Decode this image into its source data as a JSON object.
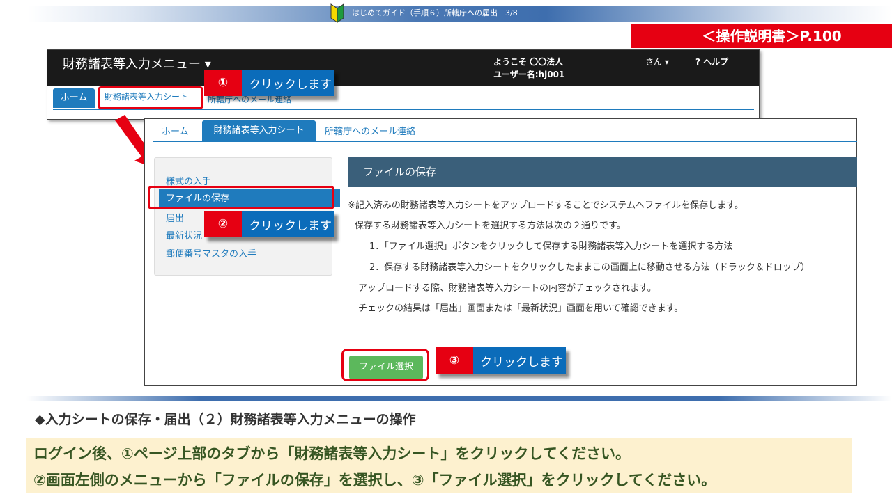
{
  "header": {
    "title": "はじめてガイド（手順６）所轄庁への届出　3/8",
    "manual_ref": "＜操作説明書＞P.100"
  },
  "screenshot1": {
    "app_title": "財務諸表等入力メニュー ▾",
    "welcome": "ようこそ 〇〇法人",
    "username": "ユーザー名:hj001",
    "san_menu": "さん ▾",
    "help": "? ヘルプ",
    "tabs": {
      "home": "ホーム",
      "sheet": "財務諸表等入力シート",
      "mail": "所轄庁へのメール連絡"
    }
  },
  "screenshot2": {
    "tabs": {
      "home": "ホーム",
      "sheet": "財務諸表等入力シート",
      "mail": "所轄庁へのメール連絡"
    },
    "sidebar": {
      "items": [
        "様式の入手",
        "ファイルの保存",
        "届出",
        "最新状況",
        "郵便番号マスタの入手"
      ]
    },
    "panel": {
      "title": "ファイルの保存",
      "paragraphs": [
        "※記入済みの財務諸表等入力シートをアップロードすることでシステムへファイルを保存します。",
        "保存する財務諸表等入力シートを選択する方法は次の２通りです。",
        "1．「ファイル選択」ボタンをクリックして保存する財務諸表等入力シートを選択する方法",
        "2．保存する財務諸表等入力シートをクリックしたままこの画面上に移動させる方法（ドラック＆ドロップ）",
        "アップロードする際、財務諸表等入力シートの内容がチェックされます。",
        "チェックの結果は「届出」画面または「最新状況」画面を用いて確認できます。"
      ],
      "file_button": "ファイル選択"
    }
  },
  "callouts": [
    {
      "num": "①",
      "text": "クリックします"
    },
    {
      "num": "②",
      "text": "クリックします"
    },
    {
      "num": "③",
      "text": "クリックします"
    }
  ],
  "footer": {
    "section_title": "◆入力シートの保存・届出（２）財務諸表等入力メニューの操作",
    "instruction_1": "ログイン後、①ページ上部のタブから「財務諸表等入力シート」をクリックしてください。",
    "instruction_2": "②画面左側のメニューから「ファイルの保存」を選択し、③「ファイル選択」をクリックしてください。"
  },
  "colors": {
    "accent_red": "#e60012",
    "accent_blue": "#0b6cba",
    "panel_header": "#3a5f7a",
    "button_green": "#5cb85c"
  }
}
